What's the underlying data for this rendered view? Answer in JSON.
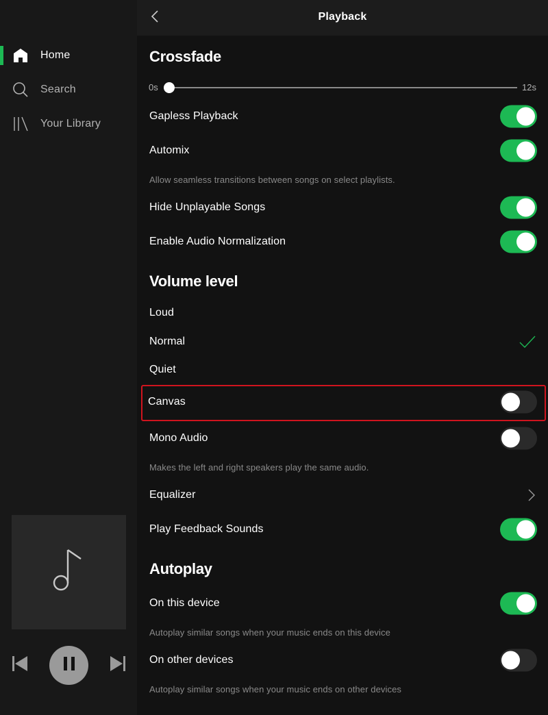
{
  "sidebar": {
    "items": [
      {
        "label": "Home",
        "icon": "home-icon",
        "active": true
      },
      {
        "label": "Search",
        "icon": "search-icon",
        "active": false
      },
      {
        "label": "Your Library",
        "icon": "library-icon",
        "active": false
      }
    ],
    "now_playing": {
      "artwork_icon": "music-note-icon",
      "controls": [
        "previous-icon",
        "pause-icon",
        "next-icon"
      ]
    }
  },
  "header": {
    "title": "Playback",
    "back_icon": "chevron-left-icon"
  },
  "colors": {
    "accent": "#1db954",
    "background": "#121212",
    "sidebar": "#181818",
    "highlight": "#d0141e"
  },
  "crossfade": {
    "title": "Crossfade",
    "min_label": "0s",
    "max_label": "12s",
    "value_seconds": 0,
    "max_seconds": 12
  },
  "playback_settings": [
    {
      "label": "Gapless Playback",
      "on": true
    },
    {
      "label": "Automix",
      "on": true,
      "description": "Allow seamless transitions between songs on select playlists."
    },
    {
      "label": "Hide Unplayable Songs",
      "on": true
    },
    {
      "label": "Enable Audio Normalization",
      "on": true
    }
  ],
  "volume_level": {
    "title": "Volume level",
    "options": [
      {
        "label": "Loud",
        "selected": false
      },
      {
        "label": "Normal",
        "selected": true
      },
      {
        "label": "Quiet",
        "selected": false
      }
    ]
  },
  "other_settings": {
    "canvas": {
      "label": "Canvas",
      "on": false
    },
    "mono_audio": {
      "label": "Mono Audio",
      "on": false,
      "description": "Makes the left and right speakers play the same audio."
    },
    "equalizer": {
      "label": "Equalizer"
    },
    "feedback_sounds": {
      "label": "Play Feedback Sounds",
      "on": true
    }
  },
  "autoplay": {
    "title": "Autoplay",
    "items": [
      {
        "label": "On this device",
        "on": true,
        "description": "Autoplay similar songs when your music ends on this device"
      },
      {
        "label": "On other devices",
        "on": false,
        "description": "Autoplay similar songs when your music ends on other devices"
      }
    ]
  }
}
